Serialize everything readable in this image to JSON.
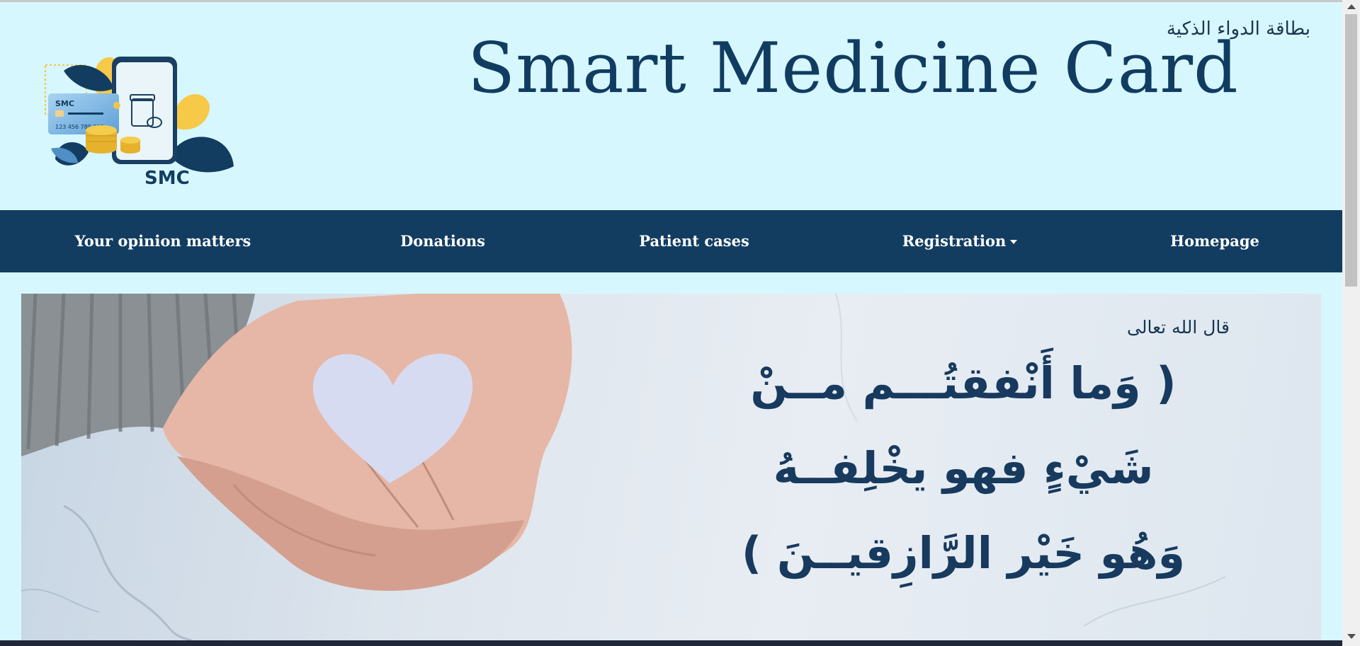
{
  "header": {
    "title": "Smart Medicine Card",
    "arabic_brand": "بطاقة الدواء الذكية",
    "logo": {
      "text": "SMC",
      "card_brand": "SMC",
      "card_number": "123  456  789  000",
      "icon": "smc-logo-icon"
    }
  },
  "nav": {
    "items": [
      {
        "label": "Your opinion matters"
      },
      {
        "label": "Donations"
      },
      {
        "label": "Patient cases"
      },
      {
        "label": "Registration",
        "dropdown": true
      },
      {
        "label": "Homepage"
      }
    ]
  },
  "banner": {
    "image": "hands-holding-paper-heart",
    "intro": "قال الله تعالى",
    "verse": [
      "( وَما أَنْفقتُـــم مــنْ",
      "شَيْءٍ فهو يخْلِفــهُ",
      "وَهُو خَيْر الرَّازِقيــنَ )"
    ]
  },
  "colors": {
    "page_background": "#d6f7fd",
    "nav_background": "#123d61",
    "title_color": "#113c61",
    "verse_color": "#173a5e"
  }
}
